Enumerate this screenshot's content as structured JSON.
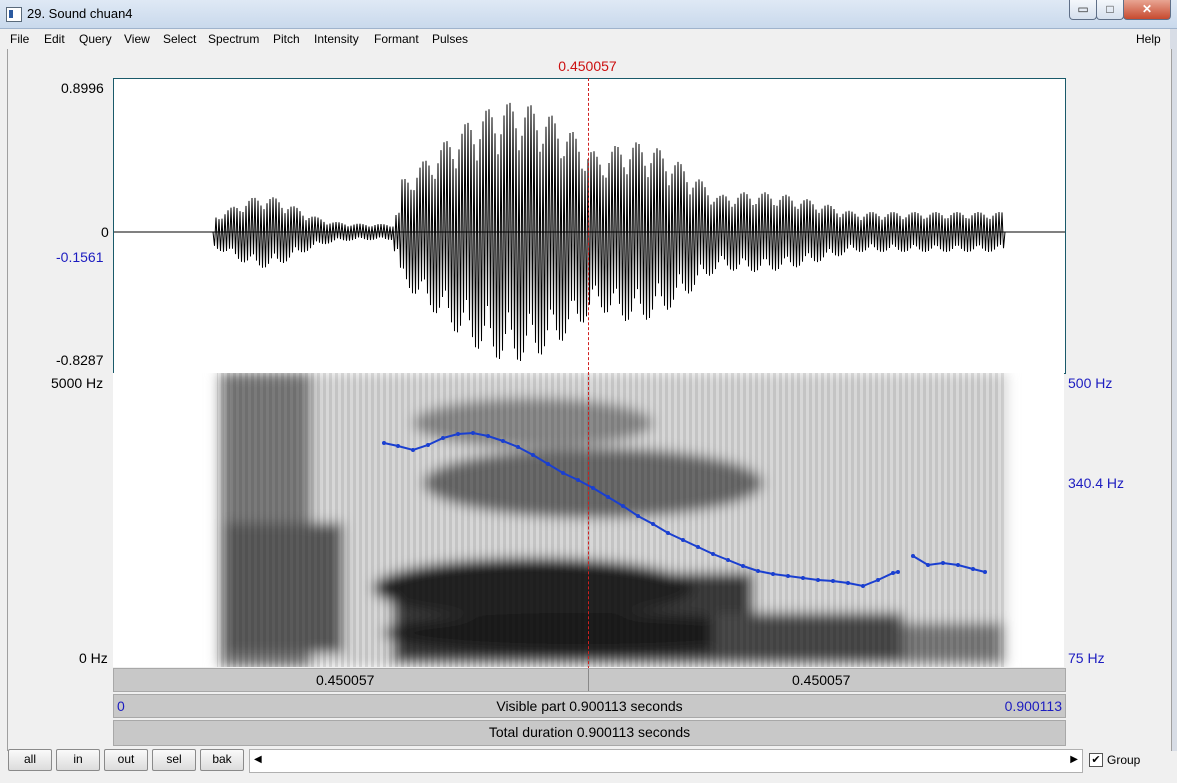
{
  "window": {
    "title": "29. Sound chuan4"
  },
  "window_controls": {
    "minimize": "▭",
    "maximize": "□",
    "close": "✕"
  },
  "menu": {
    "items": [
      "File",
      "Edit",
      "Query",
      "View",
      "Select",
      "Spectrum",
      "Pitch",
      "Intensity",
      "Formant",
      "Pulses"
    ],
    "help": "Help"
  },
  "cursor": {
    "time": "0.450057",
    "position_fraction": 0.5
  },
  "waveform": {
    "y_max": "0.8996",
    "y_zero": "0",
    "y_cursor": "-0.1561",
    "y_min": "-0.8287"
  },
  "spectrogram": {
    "freq_top": "5000 Hz",
    "freq_bottom": "0 Hz"
  },
  "pitch": {
    "top": "500 Hz",
    "cursor": "340.4 Hz",
    "bottom": "75 Hz",
    "color": "#1a3fd0"
  },
  "time_bar": {
    "left_segment": "0.450057",
    "right_segment": "0.450057"
  },
  "visible_bar": {
    "start": "0",
    "label": "Visible part 0.900113 seconds",
    "end": "0.900113"
  },
  "total_bar": {
    "label": "Total duration 0.900113 seconds"
  },
  "buttons": {
    "all": "all",
    "in": "in",
    "out": "out",
    "sel": "sel",
    "bak": "bak"
  },
  "scroll": {
    "left": "◀",
    "right": "▶"
  },
  "group": {
    "label": "Group",
    "checked": "✔"
  }
}
